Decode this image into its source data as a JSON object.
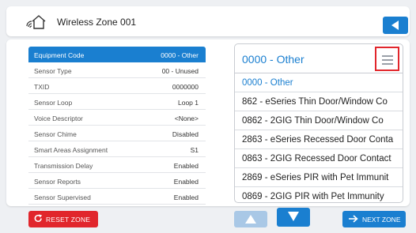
{
  "header": {
    "title": "Wireless Zone 001",
    "zone_icon": "wireless-sensor-house-icon",
    "back_icon": "back-arrow-icon"
  },
  "properties": [
    {
      "label": "Equipment Code",
      "value": "0000 - Other",
      "selected": true
    },
    {
      "label": "Sensor Type",
      "value": "00 - Unused"
    },
    {
      "label": "TXID",
      "value": "0000000"
    },
    {
      "label": "Sensor Loop",
      "value": "Loop 1"
    },
    {
      "label": "Voice Descriptor",
      "value": "<None>"
    },
    {
      "label": "Sensor Chime",
      "value": "Disabled"
    },
    {
      "label": "Smart Areas Assignment",
      "value": "S1"
    },
    {
      "label": "Transmission Delay",
      "value": "Enabled"
    },
    {
      "label": "Sensor Reports",
      "value": "Enabled"
    },
    {
      "label": "Sensor Supervised",
      "value": "Enabled"
    }
  ],
  "picker": {
    "selected": "0000 - Other",
    "menu_icon": "hamburger-menu-icon",
    "options": [
      "0000 - Other",
      "862 - eSeries Thin Door/Window Co",
      "0862 - 2GIG Thin Door/Window Co",
      "2863 - eSeries Recessed Door Conta",
      "0863 - 2GIG Recessed Door Contact",
      "2869 - eSeries PIR with Pet Immunit",
      "0869 - 2GIG PIR with Pet Immunity"
    ]
  },
  "footer": {
    "reset_label": "RESET ZONE",
    "next_label": "NEXT ZONE",
    "reset_icon": "refresh-icon",
    "up_icon": "up-arrow-icon",
    "down_icon": "down-arrow-icon",
    "next_icon": "right-arrow-icon"
  },
  "colors": {
    "accent": "#1a7fd0",
    "danger": "#e1262c",
    "disabled": "#a9c8e6"
  }
}
